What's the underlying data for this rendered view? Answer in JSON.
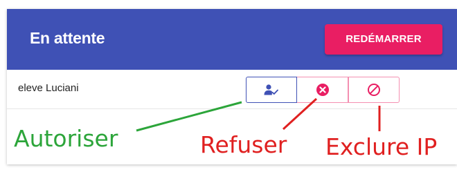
{
  "header": {
    "title": "En attente",
    "restart_label": "REDÉMARRER"
  },
  "row": {
    "student_name": "eleve Luciani",
    "actions": [
      {
        "name": "authorize",
        "icon": "person-check-icon"
      },
      {
        "name": "refuse",
        "icon": "cancel-circle-icon"
      },
      {
        "name": "exclude-ip",
        "icon": "block-icon"
      }
    ]
  },
  "annotations": {
    "authorize": "Autoriser",
    "refuse": "Refuser",
    "exclude": "Exclure IP"
  },
  "colors": {
    "header_bg": "#3f51b5",
    "accent": "#e91e63",
    "annotation_green": "#2ca53a",
    "annotation_red": "#e02020"
  }
}
